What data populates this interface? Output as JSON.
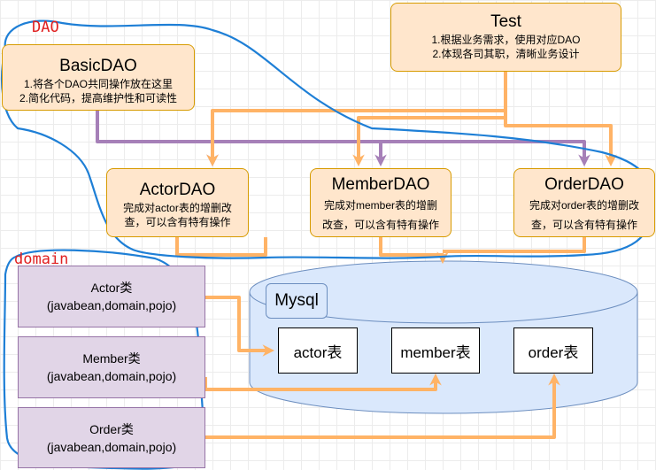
{
  "labels": {
    "dao_group": "DAO",
    "domain_group": "domain"
  },
  "test": {
    "title": "Test",
    "line1": "1.根据业务需求，使用对应DAO",
    "line2": "2.体现各司其职，清晰业务设计"
  },
  "basic_dao": {
    "title": "BasicDAO",
    "line1": "1.将各个DAO共同操作放在这里",
    "line2": "2.简化代码，提高维护性和可读性"
  },
  "actor_dao": {
    "title": "ActorDAO",
    "line1": "完成对actor表的增删改",
    "line2": "查，可以含有特有操作"
  },
  "member_dao": {
    "title": "MemberDAO",
    "line1": "完成对member表的增删",
    "line2": "改查，可以含有特有操作"
  },
  "order_dao": {
    "title": "OrderDAO",
    "line1": "完成对order表的增删改",
    "line2": "查，可以含有特有操作"
  },
  "actor_class": {
    "line1": "Actor类",
    "line2": "(javabean,domain,pojo)"
  },
  "member_class": {
    "line1": "Member类",
    "line2": "(javabean,domain,pojo)"
  },
  "order_class": {
    "line1": "Order类",
    "line2": "(javabean,domain,pojo)"
  },
  "mysql": {
    "label": "Mysql"
  },
  "tables": {
    "actor": "actor表",
    "member": "member表",
    "order": "order表"
  },
  "colors": {
    "dao_fill": "#ffe6cc",
    "dao_stroke": "#d79b00",
    "domain_fill": "#e1d5e7",
    "domain_stroke": "#9673a6",
    "db_fill": "#dae8fc",
    "db_stroke": "#6c8ebf",
    "orange_arrow": "#ffb366",
    "purple_arrow": "#a680b8",
    "group_outline": "#1e7fd6",
    "group_label": "#e02020"
  }
}
